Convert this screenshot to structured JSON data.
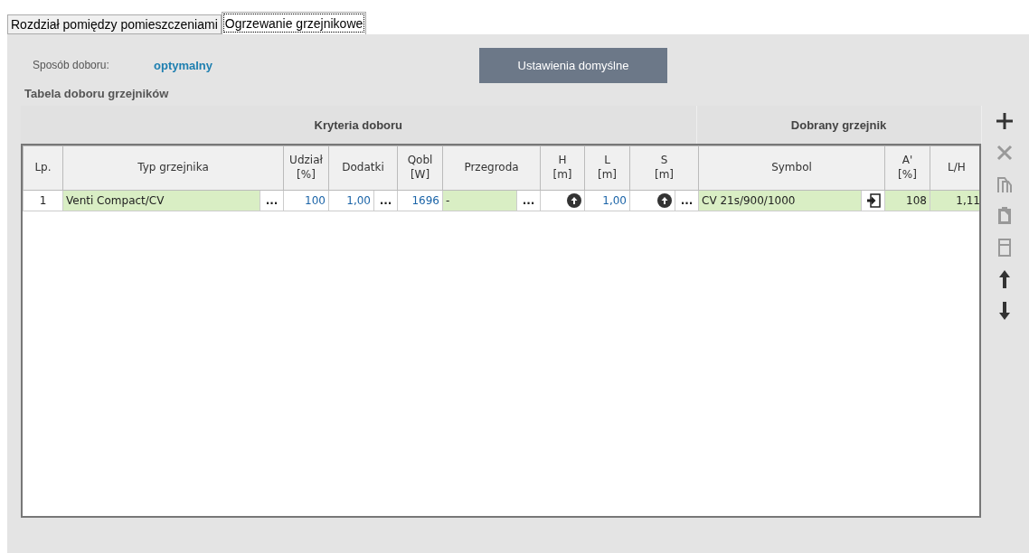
{
  "tabs": [
    {
      "label": "Rozdział pomiędzy pomieszczeniami",
      "selected": false
    },
    {
      "label": "Ogrzewanie grzejnikowe",
      "selected": true
    }
  ],
  "selection": {
    "label": "Sposób doboru:",
    "value": "optymalny"
  },
  "default_button": "Ustawienia domyślne",
  "group_title": "Tabela doboru grzejników",
  "table": {
    "bands": [
      "Kryteria doboru",
      "Dobrany grzejnik"
    ],
    "columns": [
      "Lp.",
      "Typ grzejnika",
      "Udział\n[%]",
      "Dodatki",
      "Qobl\n[W]",
      "Przegroda",
      "H\n[m]",
      "L\n[m]",
      "S\n[m]",
      "Symbol",
      "A'\n[%]",
      "L/H"
    ],
    "rows": [
      {
        "cells": [
          {
            "kind": "index",
            "value": "1",
            "highlighted": false
          },
          {
            "kind": "text",
            "value": "Venti Compact/CV",
            "highlighted": true,
            "button": {
              "kind": "dots",
              "label": "..."
            }
          },
          {
            "kind": "number",
            "value": "100",
            "highlighted": false
          },
          {
            "kind": "number",
            "value": "1,00",
            "highlighted": false,
            "button": {
              "kind": "dots",
              "label": "..."
            }
          },
          {
            "kind": "number",
            "value": "1696",
            "highlighted": false
          },
          {
            "kind": "text",
            "value": "-",
            "highlighted": true,
            "button": {
              "kind": "dots",
              "label": "..."
            }
          },
          {
            "kind": "up",
            "highlighted": false
          },
          {
            "kind": "number",
            "value": "1,00",
            "highlighted": false
          },
          {
            "kind": "up",
            "highlighted": false,
            "button": {
              "kind": "dots",
              "label": "..."
            }
          },
          {
            "kind": "text",
            "value": "CV 21s/900/1000",
            "highlighted": true,
            "button": {
              "kind": "enter"
            }
          },
          {
            "kind": "plain",
            "value": "108",
            "highlighted": true
          },
          {
            "kind": "plain",
            "value": "1,11",
            "highlighted": true
          }
        ]
      }
    ]
  },
  "toolbar": [
    {
      "kind": "add",
      "disabled": false
    },
    {
      "kind": "delete",
      "disabled": true
    },
    {
      "kind": "copy",
      "disabled": true
    },
    {
      "kind": "paste",
      "disabled": true
    },
    {
      "kind": "calculator",
      "disabled": true
    },
    {
      "kind": "move-up",
      "disabled": false
    },
    {
      "kind": "move-down",
      "disabled": false
    }
  ]
}
